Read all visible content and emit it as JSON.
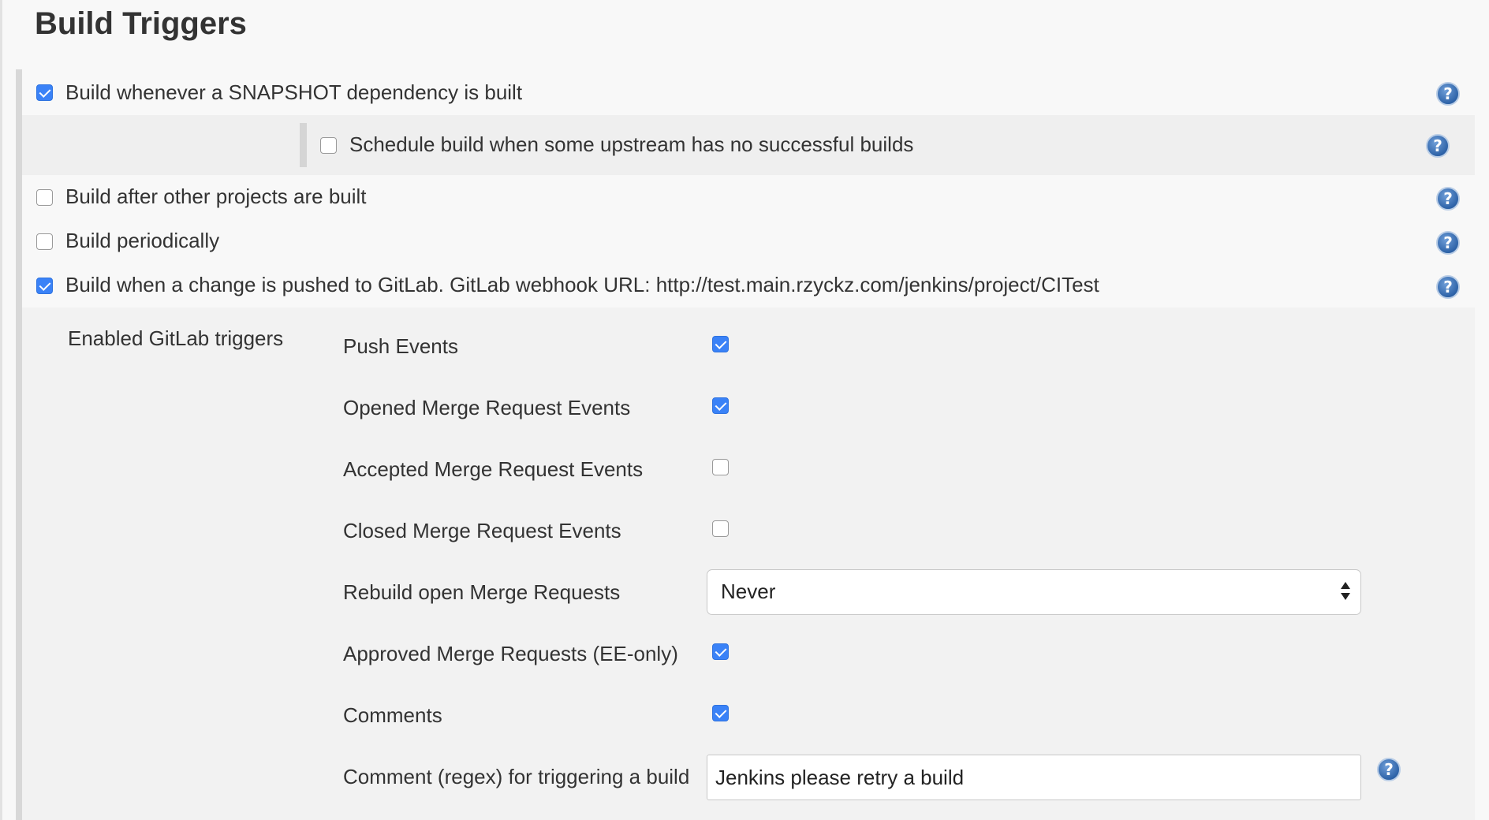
{
  "section": {
    "title": "Build Triggers"
  },
  "triggers": {
    "snapshot": {
      "label": "Build whenever a SNAPSHOT dependency is built",
      "checked": true
    },
    "upstream": {
      "label": "Schedule build when some upstream has no successful builds",
      "checked": false
    },
    "after_other": {
      "label": "Build after other projects are built",
      "checked": false
    },
    "periodically": {
      "label": "Build periodically",
      "checked": false
    },
    "gitlab": {
      "label": "Build when a change is pushed to GitLab. GitLab webhook URL: http://test.main.rzyckz.com/jenkins/project/CITest",
      "checked": true
    }
  },
  "gitlab_triggers": {
    "heading": "Enabled GitLab triggers",
    "push_events": {
      "label": "Push Events",
      "checked": true
    },
    "opened_mr": {
      "label": "Opened Merge Request Events",
      "checked": true
    },
    "accepted_mr": {
      "label": "Accepted Merge Request Events",
      "checked": false
    },
    "closed_mr": {
      "label": "Closed Merge Request Events",
      "checked": false
    },
    "rebuild": {
      "label": "Rebuild open Merge Requests",
      "value": "Never"
    },
    "approved_mr": {
      "label": "Approved Merge Requests (EE-only)",
      "checked": true
    },
    "comments": {
      "label": "Comments",
      "checked": true
    },
    "comment_regex": {
      "label": "Comment (regex) for triggering a build",
      "value": "Jenkins please retry a build"
    }
  },
  "help_icon": "question-mark-icon",
  "colors": {
    "accent": "#3a82f7",
    "help": "#2e63a8"
  }
}
